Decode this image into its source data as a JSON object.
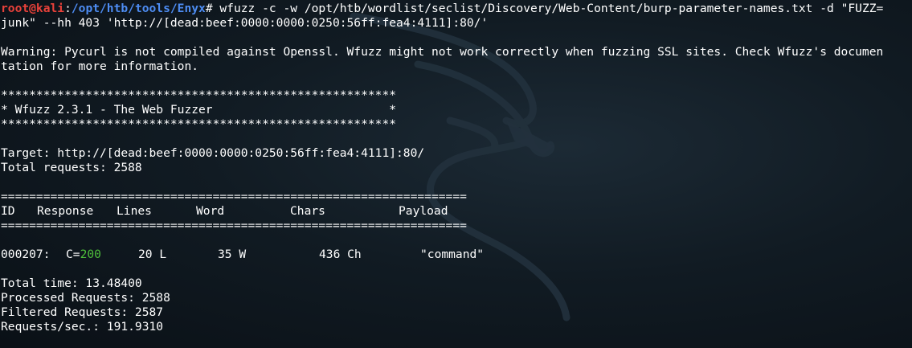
{
  "prompt": {
    "user_host": "root@kali",
    "sep": ":",
    "path": "/opt/htb/tools/Enyx",
    "symbol": "#"
  },
  "command": {
    "line1": " wfuzz -c -w /opt/htb/wordlist/seclist/Discovery/Web-Content/burp-parameter-names.txt -d \"FUZZ=",
    "line2": "junk\" --hh 403 'http://[dead:beef:0000:0000:0250:56ff:fea4:4111]:80/'"
  },
  "warning": {
    "line1": "Warning: Pycurl is not compiled against Openssl. Wfuzz might not work correctly when fuzzing SSL sites. Check Wfuzz's documen",
    "line2": "tation for more information."
  },
  "banner": {
    "stars": "********************************************************",
    "title": "* Wfuzz 2.3.1 - The Web Fuzzer                         *"
  },
  "target": "Target: http://[dead:beef:0000:0000:0250:56ff:fea4:4111]:80/",
  "total_requests": "Total requests: 2588",
  "table": {
    "divider": "==================================================================",
    "headers": {
      "id": "ID",
      "response": "Response",
      "lines": "Lines",
      "word": "Word",
      "chars": "Chars",
      "payload": "Payload"
    },
    "row": {
      "id": "000207:",
      "code_prefix": "C=",
      "code": "200",
      "lines": "20 L",
      "word": "35 W",
      "chars": "436 Ch",
      "payload": "\"command\""
    }
  },
  "summary": {
    "total_time": "Total time: 13.48400",
    "processed": "Processed Requests: 2588",
    "filtered": "Filtered Requests: 2587",
    "rate": "Requests/sec.: 191.9310"
  },
  "colors": {
    "background": "#0b1219",
    "prompt_user": "#e8413a",
    "prompt_path": "#4d8cf2",
    "status_ok": "#4ebf3b",
    "text": "#ffffff"
  },
  "watermark_icon": "kali-dragon-icon"
}
